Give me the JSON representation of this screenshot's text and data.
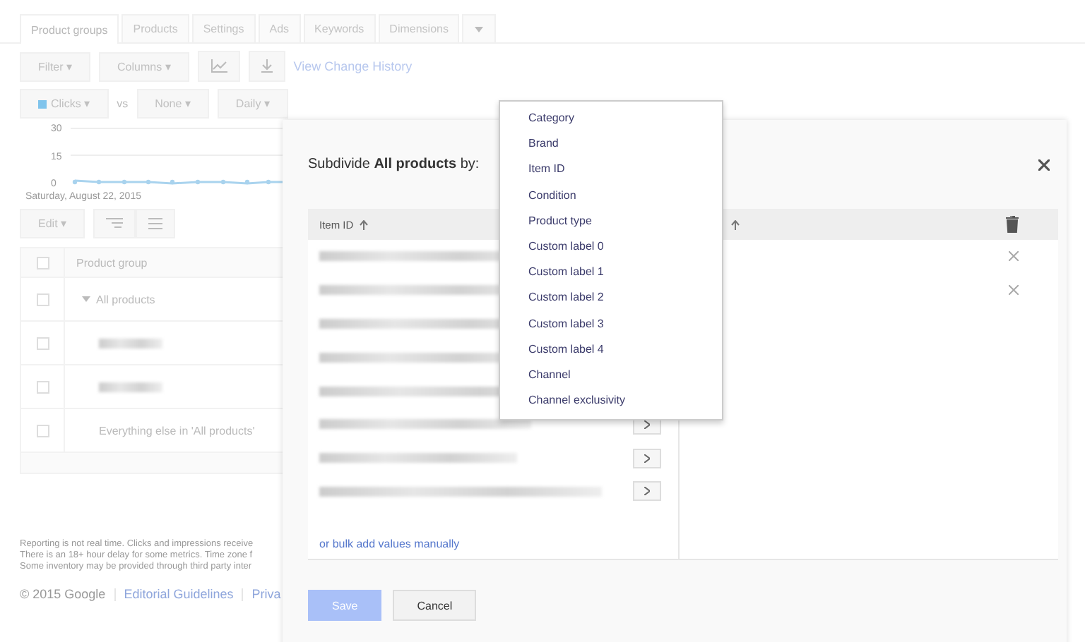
{
  "tabs": [
    {
      "label": "Product groups",
      "selected": true
    },
    {
      "label": "Products",
      "selected": false
    },
    {
      "label": "Settings",
      "selected": false
    },
    {
      "label": "Ads",
      "selected": false
    },
    {
      "label": "Keywords",
      "selected": false
    },
    {
      "label": "Dimensions",
      "selected": false
    }
  ],
  "toolbar": {
    "filter": "Filter ▾",
    "columns": "Columns ▾",
    "link": "View Change History"
  },
  "metrics": {
    "metric": "Clicks ▾",
    "vs": "vs",
    "compare": "None ▾",
    "period": "Daily ▾"
  },
  "chart": {
    "y_labels": [
      "30",
      "15",
      "0"
    ],
    "date": "Saturday, August 22, 2015"
  },
  "edit_button": "Edit ▾",
  "table": {
    "header": "Product group",
    "all_checked": false,
    "rows": [
      {
        "kind": "group",
        "label": "All products",
        "checked": false
      },
      {
        "kind": "redacted",
        "checked": false
      },
      {
        "kind": "redacted",
        "checked": false
      },
      {
        "kind": "other",
        "label": "Everything else in 'All products'",
        "checked": false
      }
    ]
  },
  "footer": {
    "notes": [
      "Reporting is not real time. Clicks and impressions receive",
      "There is an 18+ hour delay for some metrics. Time zone f",
      "Some inventory may be provided through third party inter"
    ],
    "links": [
      "© 2015 Google",
      "Editorial Guidelines",
      "Priva"
    ]
  },
  "dialog": {
    "title": "Subdivide **All products** by:",
    "left_header": "Item ID",
    "bulk_link": "or bulk add values manually",
    "save": {
      "label": "Save",
      "disabled": true
    },
    "cancel": "Cancel"
  },
  "dropdown": [
    "Category",
    "Brand",
    "Item ID",
    "Condition",
    "Product type",
    "Custom label 0",
    "Custom label 1",
    "Custom label 2",
    "Custom label 3",
    "Custom label 4",
    "Channel",
    "Channel exclusivity"
  ]
}
